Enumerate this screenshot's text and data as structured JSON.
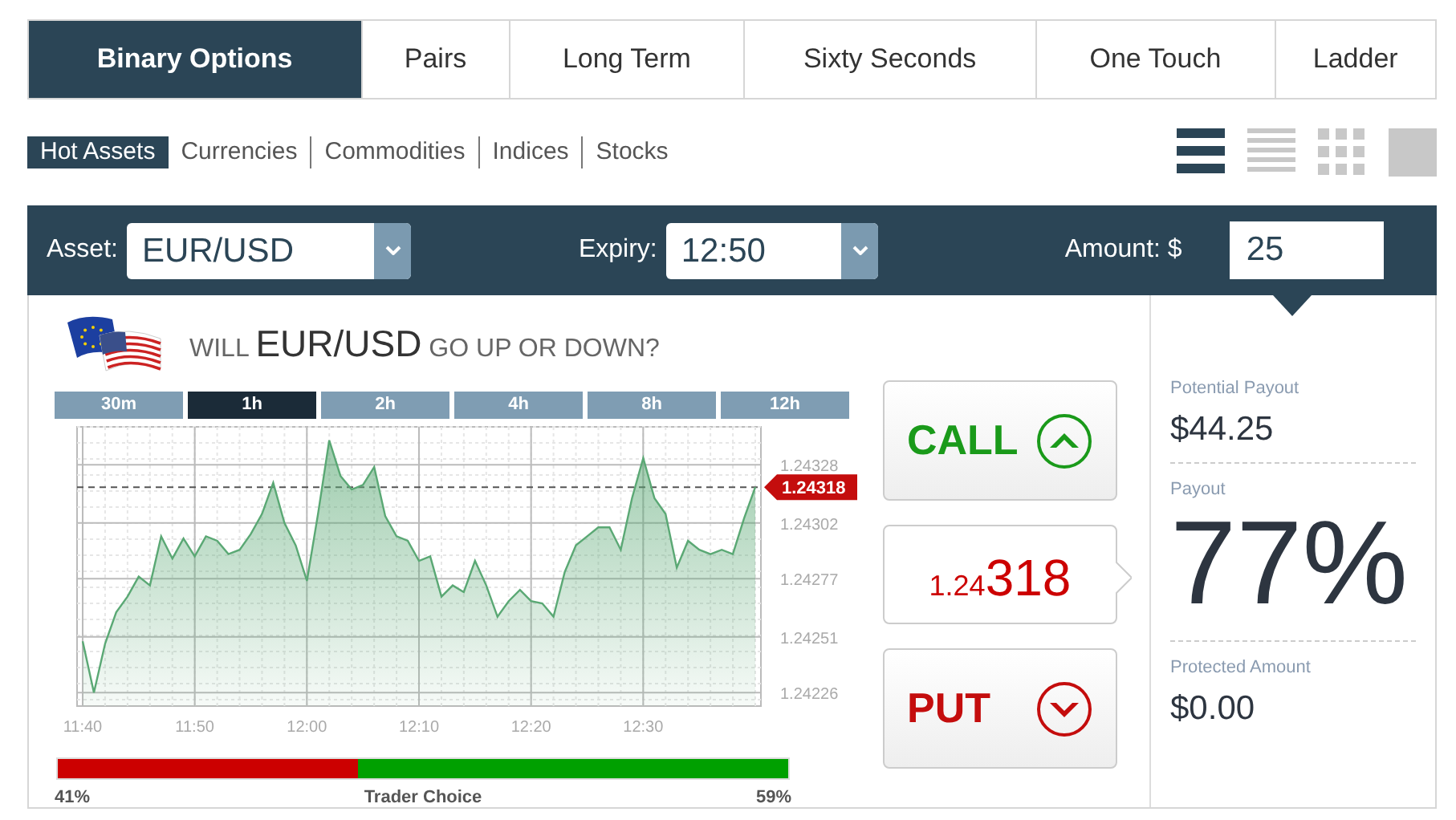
{
  "product_tabs": [
    {
      "label": "Binary Options",
      "selected": true
    },
    {
      "label": "Pairs",
      "selected": false
    },
    {
      "label": "Long Term",
      "selected": false
    },
    {
      "label": "Sixty Seconds",
      "selected": false
    },
    {
      "label": "One Touch",
      "selected": false
    },
    {
      "label": "Ladder",
      "selected": false
    }
  ],
  "asset_filters": [
    {
      "label": "Hot Assets",
      "selected": true
    },
    {
      "label": "Currencies",
      "selected": false
    },
    {
      "label": "Commodities",
      "selected": false
    },
    {
      "label": "Indices",
      "selected": false
    },
    {
      "label": "Stocks",
      "selected": false
    }
  ],
  "view_modes": [
    {
      "kind": "list",
      "selected": true
    },
    {
      "kind": "compact",
      "selected": false
    },
    {
      "kind": "grid",
      "selected": false
    },
    {
      "kind": "single",
      "selected": false
    }
  ],
  "trade_bar": {
    "asset_label": "Asset:",
    "asset_value": "EUR/USD",
    "expiry_label": "Expiry:",
    "expiry_value": "12:50",
    "amount_label": "Amount: $",
    "amount_value": "25"
  },
  "question": {
    "prefix": "WILL",
    "asset": "EUR/USD",
    "suffix": "GO UP OR DOWN?"
  },
  "timeframes": [
    {
      "label": "30m",
      "selected": false
    },
    {
      "label": "1h",
      "selected": true
    },
    {
      "label": "2h",
      "selected": false
    },
    {
      "label": "4h",
      "selected": false
    },
    {
      "label": "8h",
      "selected": false
    },
    {
      "label": "12h",
      "selected": false
    }
  ],
  "chart_data": {
    "type": "area",
    "categories": [
      "11:40",
      null,
      null,
      null,
      null,
      null,
      null,
      null,
      null,
      null,
      "11:50",
      null,
      null,
      null,
      null,
      null,
      null,
      null,
      null,
      null,
      "12:00",
      null,
      null,
      null,
      null,
      null,
      null,
      null,
      null,
      null,
      "12:10",
      null,
      null,
      null,
      null,
      null,
      null,
      null,
      null,
      null,
      "12:20",
      null,
      null,
      null,
      null,
      null,
      null,
      null,
      null,
      null,
      "12:30",
      null,
      null,
      null,
      null,
      null,
      null,
      null,
      null,
      null,
      null
    ],
    "series": [
      {
        "color": "#5aa874",
        "values": [
          1.24249,
          1.24226,
          1.24248,
          1.24262,
          1.24269,
          1.24278,
          1.24274,
          1.24296,
          1.24286,
          1.24295,
          1.24287,
          1.24296,
          1.24294,
          1.24288,
          1.2429,
          1.24297,
          1.24306,
          1.2432,
          1.24302,
          1.24292,
          1.24276,
          1.24306,
          1.24339,
          1.24323,
          1.24317,
          1.24319,
          1.24327,
          1.24305,
          1.24296,
          1.24294,
          1.24285,
          1.24287,
          1.24269,
          1.24274,
          1.24271,
          1.24285,
          1.24274,
          1.2426,
          1.24267,
          1.24272,
          1.24267,
          1.24266,
          1.2426,
          1.2428,
          1.24292,
          1.24296,
          1.243,
          1.243,
          1.2429,
          1.24313,
          1.24331,
          1.24313,
          1.24306,
          1.24282,
          1.24294,
          1.2429,
          1.24288,
          1.2429,
          1.24288,
          1.24304,
          1.24318
        ]
      }
    ],
    "ylim": [
      1.2422,
      1.24345
    ],
    "yticks": [
      1.24226,
      1.24251,
      1.24277,
      1.24302,
      1.24328
    ],
    "grid": true,
    "ref_lines": [
      {
        "axis": "y",
        "value": 1.24318,
        "label": "1.24318"
      }
    ]
  },
  "trader_choice": {
    "level": 0.41,
    "put_share": "41%",
    "label": "Trader Choice",
    "call_share": "59%"
  },
  "call_button": {
    "label": "CALL"
  },
  "current_price": {
    "prefix": "1.24",
    "main": "318"
  },
  "put_button": {
    "label": "PUT"
  },
  "payout_panel": [
    {
      "label": "Potential Payout",
      "value": "$44.25",
      "kind": "amount"
    },
    {
      "label": "Payout",
      "value": "77%",
      "kind": "percent"
    },
    {
      "label": "Protected Amount",
      "value": "$0.00",
      "kind": "amount"
    }
  ]
}
